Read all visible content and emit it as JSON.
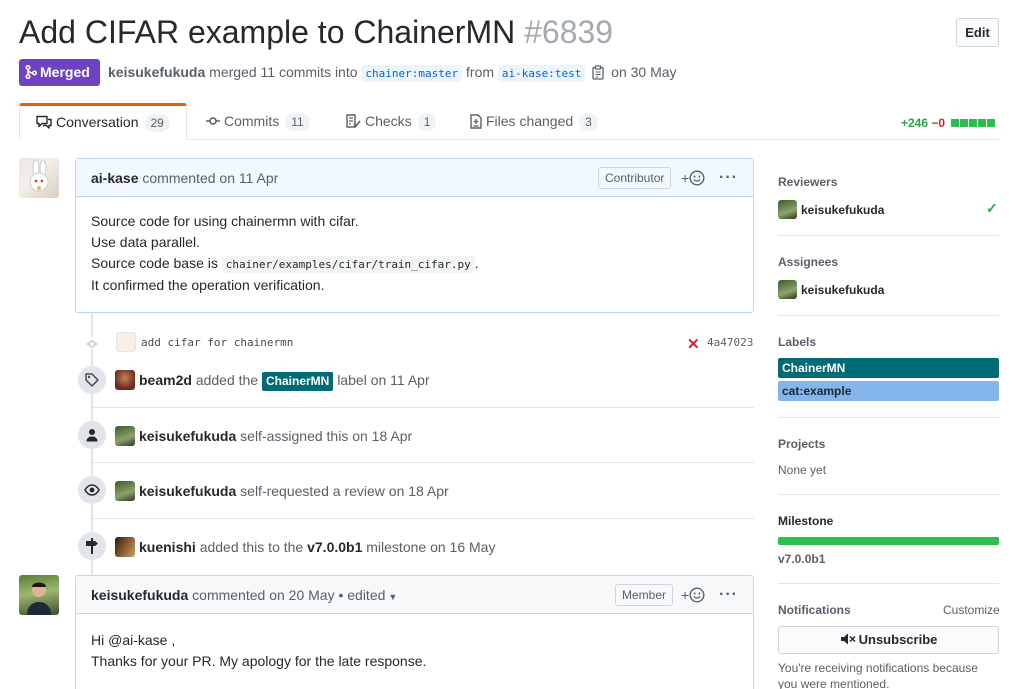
{
  "header": {
    "title": "Add CIFAR example to ChainerMN",
    "number": "#6839",
    "edit_label": "Edit",
    "state": "Merged",
    "author": "keisukefukuda",
    "merged_text": "merged 11 commits into",
    "base_branch": "chainer:master",
    "from_text": "from",
    "head_branch": "ai-kase:test",
    "date_text": "on 30 May"
  },
  "tabs": [
    {
      "label": "Conversation",
      "count": "29"
    },
    {
      "label": "Commits",
      "count": "11"
    },
    {
      "label": "Checks",
      "count": "1"
    },
    {
      "label": "Files changed",
      "count": "3"
    }
  ],
  "diffstat": {
    "additions": "+246",
    "deletions": "−0"
  },
  "comment1": {
    "author": "ai-kase",
    "action": "commented on 11 Apr",
    "role": "Contributor",
    "lines": [
      "Source code for using chainermn with cifar.",
      "Use data parallel.",
      "Source code base is",
      "It confirmed the operation verification."
    ],
    "code": "chainer/examples/cifar/train_cifar.py",
    "dot": "."
  },
  "commit": {
    "message": "add cifar for chainermn",
    "sha": "4a47023"
  },
  "events": [
    {
      "user": "beam2d",
      "pre": "added the",
      "label": "ChainerMN",
      "post": "label on 11 Apr"
    },
    {
      "user": "keisukefukuda",
      "text": "self-assigned this on 18 Apr"
    },
    {
      "user": "keisukefukuda",
      "text": "self-requested a review on 18 Apr"
    },
    {
      "user": "kuenishi",
      "pre": "added this to the",
      "milestone": "v7.0.0b1",
      "post": "milestone on 16 May"
    }
  ],
  "comment2": {
    "author": "keisukefukuda",
    "action": "commented on 20 May • edited",
    "role": "Member",
    "lines": [
      "Hi @ai-kase ,",
      "Thanks for your PR. My apology for the late response."
    ]
  },
  "sidebar": {
    "reviewers_title": "Reviewers",
    "reviewer": "keisukefukuda",
    "assignees_title": "Assignees",
    "assignee": "keisukefukuda",
    "labels_title": "Labels",
    "labels": [
      {
        "name": "ChainerMN",
        "color": "#006b75"
      },
      {
        "name": "cat:example",
        "color": "#84b6eb"
      }
    ],
    "projects_title": "Projects",
    "projects_value": "None yet",
    "milestone_title": "Milestone",
    "milestone_value": "v7.0.0b1",
    "milestone_progress": 1.0,
    "notifications_title": "Notifications",
    "customize_label": "Customize",
    "unsubscribe_label": "Unsubscribe",
    "notif_reason": [
      "You're receiving notifications because",
      "you were mentioned."
    ]
  },
  "colors": {
    "merged": "#6f42c1",
    "additions": "#28a745",
    "deletions": "#cb2431",
    "tab_accent": "#e36209"
  }
}
